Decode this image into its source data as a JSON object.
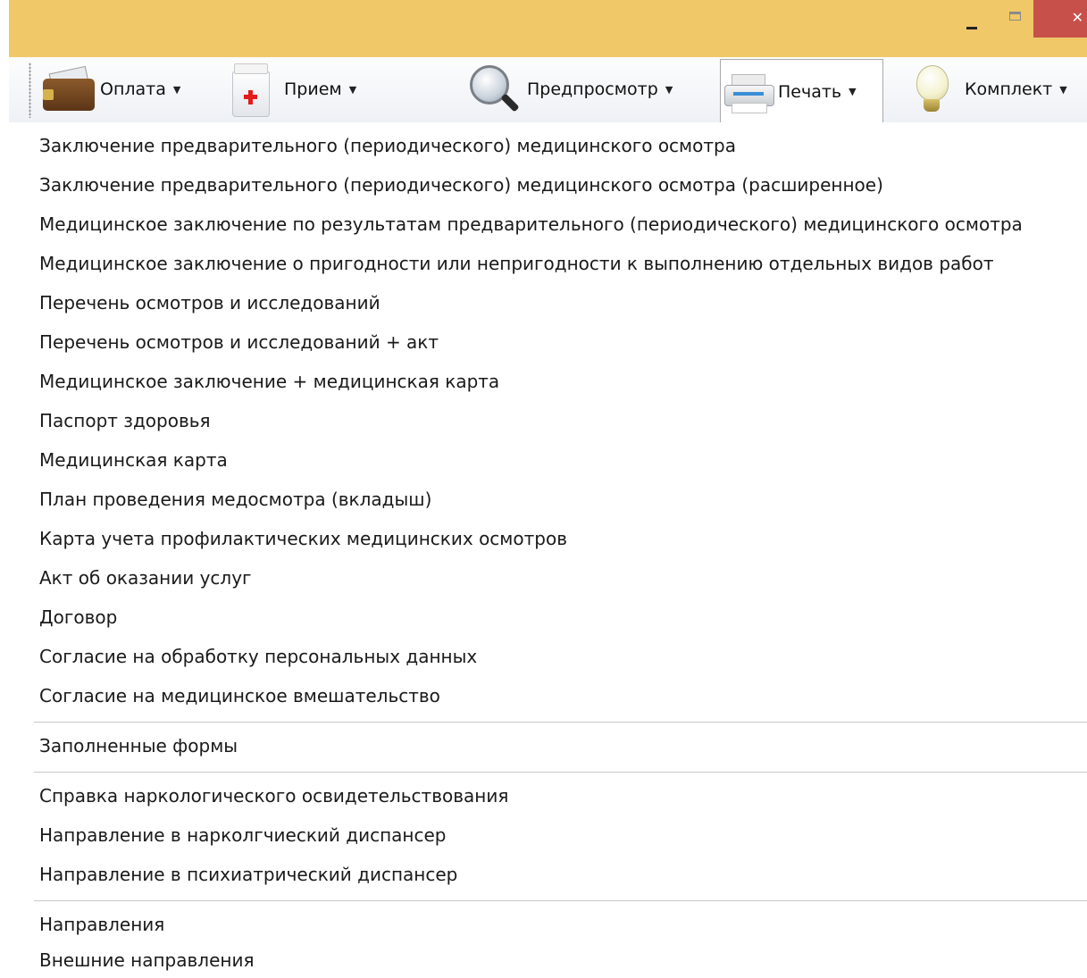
{
  "window": {
    "close_glyph": "✕"
  },
  "toolbar": {
    "buttons": [
      {
        "label": "Оплата",
        "icon": "wallet-icon"
      },
      {
        "label": "Прием",
        "icon": "medkit-icon"
      },
      {
        "label": "Предпросмотр",
        "icon": "magnifier-icon"
      },
      {
        "label": "Печать",
        "icon": "printer-icon",
        "pressed": true
      },
      {
        "label": "Комплект",
        "icon": "lightbulb-icon"
      }
    ],
    "dropdown_arrow": "▼"
  },
  "menu": {
    "group1": [
      "Заключение предварительного (периодического) медицинского осмотра",
      "Заключение предварительного (периодического) медицинского осмотра (расширенное)",
      "Медицинское заключение по результатам предварительного (периодического) медицинского осмотра",
      "Медицинское заключение о пригодности или непригодности к выполнению отдельных видов работ",
      "Перечень осмотров и исследований",
      "Перечень осмотров и исследований + акт",
      "Медицинское заключение + медицинская карта",
      "Паспорт здоровья",
      "Медицинская карта",
      "План проведения медосмотра (вкладыш)",
      "Карта учета профилактических медицинских осмотров",
      "Акт об оказании услуг",
      "Договор",
      "Согласие на обработку персональных данных",
      "Согласие на медицинское вмешательство"
    ],
    "group2": [
      "Заполненные формы"
    ],
    "group3": [
      "Справка наркологического освидетельствования",
      "Направление в нарколгчиеский диспансер",
      "Направление в психиатрический диспансер"
    ],
    "group4": [
      "Направления",
      "Внешние направления"
    ]
  },
  "colors": {
    "titlebar": "#f0c868",
    "close_button": "#c8504a"
  }
}
